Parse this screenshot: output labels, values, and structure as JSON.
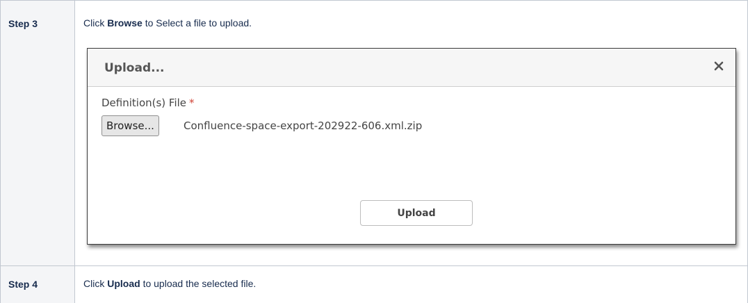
{
  "steps": [
    {
      "label": "Step 3",
      "text_prefix": "Click ",
      "text_bold": "Browse",
      "text_suffix": " to Select a file to upload."
    },
    {
      "label": "Step 4",
      "text_prefix": "Click ",
      "text_bold": "Upload",
      "text_suffix": " to upload the selected file."
    }
  ],
  "dialog": {
    "title": "Upload...",
    "close_icon": "close-icon",
    "field_label": "Definition(s) File",
    "required_mark": "*",
    "browse_label": "Browse...",
    "file_name": "Confluence-space-export-202922-606.xml.zip",
    "upload_label": "Upload"
  },
  "colors": {
    "required": "#d04437",
    "table_border": "#c1c7d0",
    "label_cell_bg": "#f4f5f7"
  }
}
